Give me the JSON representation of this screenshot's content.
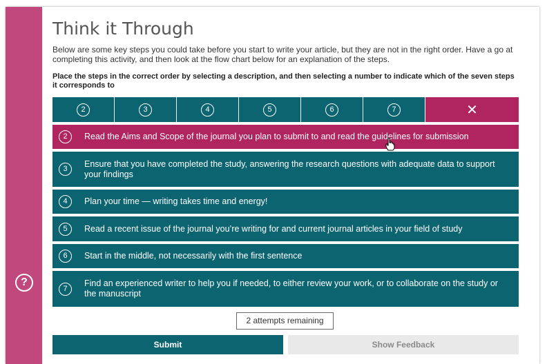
{
  "title": "Think it Through",
  "intro": "Below are some key steps you could take before you start to write your article, but they are not in the right order.  Have a go at completing this activity, and then look at the flow chart below for an explanation of the steps.",
  "instruction": "Place the steps in the correct order by selecting a description, and then selecting a number to indicate which of the seven steps it corresponds to",
  "number_options": [
    "2",
    "3",
    "4",
    "5",
    "6",
    "7"
  ],
  "close_symbol": "✕",
  "help_symbol": "?",
  "steps": [
    {
      "number": "2",
      "text": "Read the Aims and Scope of the journal you plan to submit to and read the guidelines for submission",
      "selected": true
    },
    {
      "number": "3",
      "text": "Ensure that you have completed the study, answering the research questions with adequate data to support your findings",
      "selected": false
    },
    {
      "number": "4",
      "text": "Plan your time — writing takes time and energy!",
      "selected": false
    },
    {
      "number": "5",
      "text": "Read a recent issue of the journal you’re writing for and current journal articles in your field of study",
      "selected": false
    },
    {
      "number": "6",
      "text": "Start in the middle, not necessarily with the first sentence",
      "selected": false
    },
    {
      "number": "7",
      "text": "Find an experienced writer to help you if needed, to either review your work, or to collaborate on the study or the manuscript",
      "selected": false
    }
  ],
  "attempts": "2 attempts remaining",
  "submit_label": "Submit",
  "feedback_label": "Show Feedback",
  "colors": {
    "teal": "#0b6470",
    "magenta": "#b0245f",
    "sidebar": "#c0487d"
  }
}
